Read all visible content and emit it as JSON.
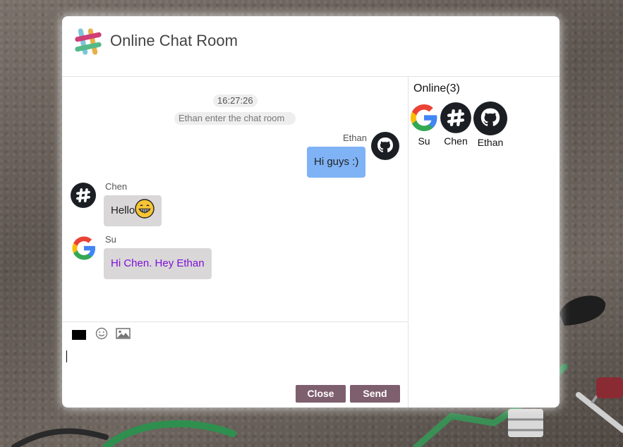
{
  "app": {
    "title": "Online Chat Room",
    "icon": "slack-icon"
  },
  "messages": {
    "time": "16:27:26",
    "system_notice": "Ethan enter the chat room",
    "items": [
      {
        "sender": "Ethan",
        "text": "Hi guys :)",
        "avatar": "github-icon",
        "side": "right"
      },
      {
        "sender": "Chen",
        "text": "Hello",
        "emoji": "grinning-face-emoji",
        "avatar": "slack-icon",
        "side": "left"
      },
      {
        "sender": "Su",
        "text": "Hi Chen. Hey Ethan",
        "avatar": "google-icon",
        "side": "left",
        "text_color": "#7d10d8"
      }
    ]
  },
  "toolbar": {
    "color": "#000000",
    "emoji_icon": "smiley-icon",
    "image_icon": "image-icon"
  },
  "input": {
    "value": ""
  },
  "buttons": {
    "close_label": "Close",
    "send_label": "Send",
    "color": "#7e5f6e"
  },
  "online": {
    "title": "Online(3)",
    "users": [
      {
        "name": "Su",
        "avatar": "google-icon"
      },
      {
        "name": "Chen",
        "avatar": "slack-icon"
      },
      {
        "name": "Ethan",
        "avatar": "github-icon"
      }
    ]
  },
  "colors": {
    "my_bubble": "#7fb3f5",
    "their_bubble": "#d9d7d7"
  }
}
